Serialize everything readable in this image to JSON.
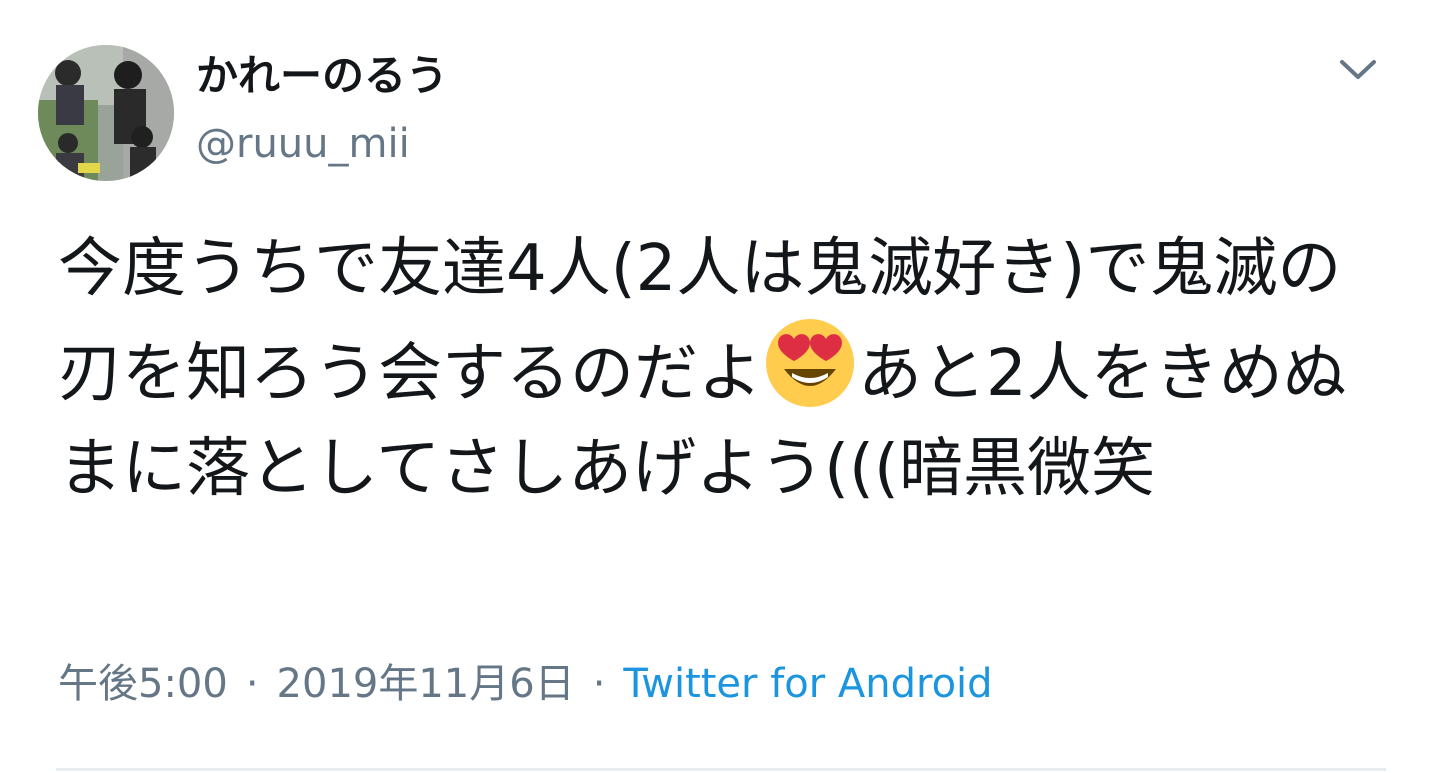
{
  "tweet": {
    "display_name": "かれーのるう",
    "handle": "@ruuu_mii",
    "text_part1": "今度うちで友達4人(2人は鬼滅好き)で鬼滅の刃を知ろう会するのだよ",
    "emoji": "smiling-face-with-heart-eyes",
    "text_part2": "あと2人をきめぬまに落としてさしあげよう(((暗黒微笑",
    "time": "午後5:00",
    "date": "2019年11月6日",
    "separator": "·",
    "source": "Twitter for Android"
  },
  "colors": {
    "text": "#14171a",
    "secondary": "#657786",
    "link": "#1b95e0",
    "divider": "#e6ecf0"
  }
}
